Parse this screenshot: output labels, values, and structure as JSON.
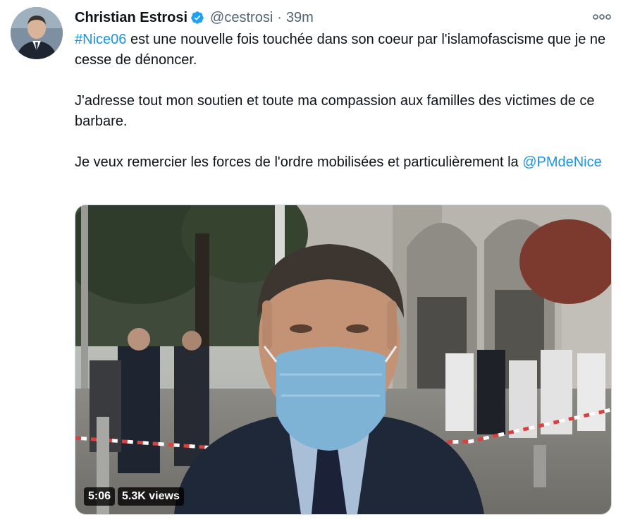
{
  "author": {
    "display_name": "Christian Estrosi",
    "handle": "@cestrosi",
    "separator": "·",
    "time": "39m",
    "verified_icon": "verified-badge-icon",
    "verified_color": "#1da1f2"
  },
  "menu": {
    "icon": "more-dots-icon"
  },
  "tweet": {
    "hashtag": "#Nice06",
    "line1_rest": " est une nouvelle fois touchée dans son coeur par l'islamofascisme que je ne cesse de dénoncer.",
    "paragraph2": "J'adresse tout mon soutien et toute ma compassion aux familles des victimes de ce barbare.",
    "paragraph3": "Je veux remercier les forces de l'ordre mobilisées et particulièrement la ",
    "mention": "@PMdeNice",
    "link_color": "#1b95e0"
  },
  "video": {
    "duration": "5:06",
    "views": "5.3K views"
  }
}
